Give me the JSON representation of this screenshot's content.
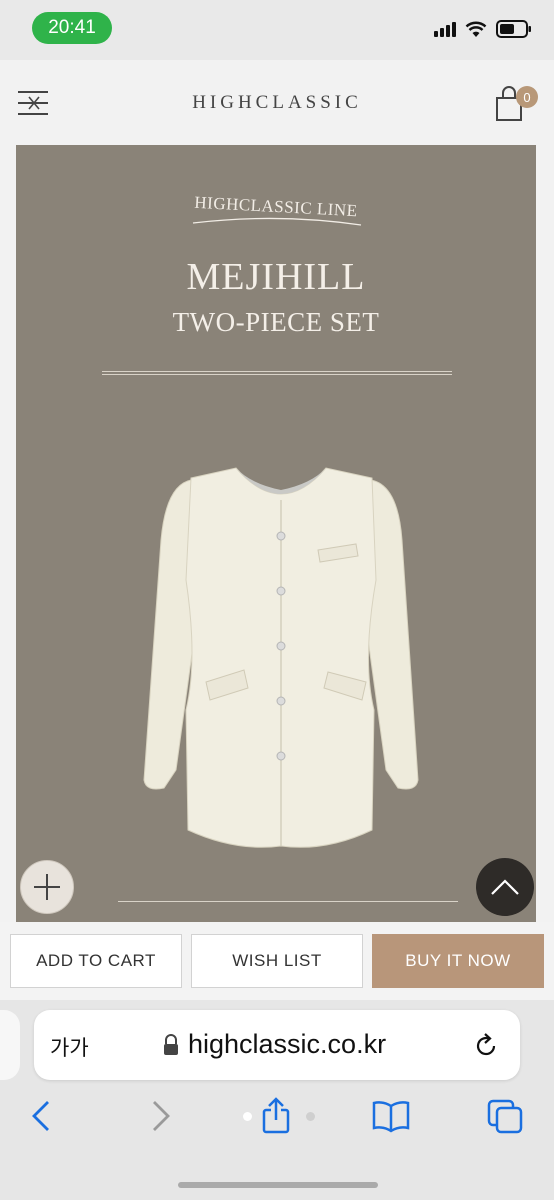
{
  "status_bar": {
    "time": "20:41"
  },
  "header": {
    "brand": "HIGHCLASSIC",
    "cart_count": "0"
  },
  "hero": {
    "line_logo": "HIGHCLASSIC LINE",
    "title": "MEJIHILL",
    "subtitle": "TWO-PIECE SET"
  },
  "actions": {
    "add_to_cart": "ADD TO CART",
    "wish_list": "WISH LIST",
    "buy_now": "BUY IT NOW"
  },
  "safari": {
    "text_size": "가가",
    "url": "highclassic.co.kr"
  },
  "colors": {
    "hero_bg": "#8a8378",
    "buy_button": "#b8967a",
    "ios_blue": "#1a6fe0",
    "time_pill": "#2fb34a"
  },
  "icons": [
    "menu-icon",
    "cart-icon",
    "plus-icon",
    "chevron-up-icon",
    "lock-icon",
    "reload-icon",
    "back-icon",
    "forward-icon",
    "share-icon",
    "bookmarks-icon",
    "tabs-icon",
    "signal-icon",
    "wifi-icon",
    "battery-icon"
  ]
}
